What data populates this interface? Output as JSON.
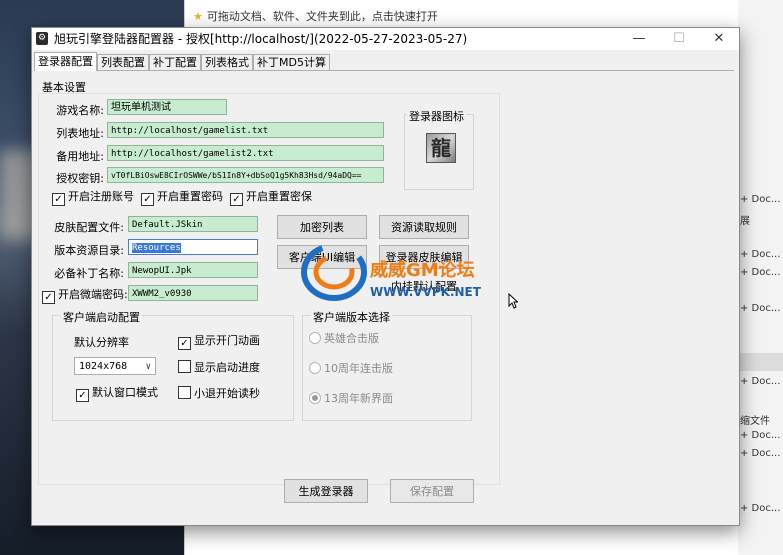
{
  "background": {
    "hint_text": "可拖动文档、软件、文件夹到此，点击快速打开",
    "right_list": [
      "+ Doc...",
      "展",
      "+ Doc...",
      "+ Doc...",
      "+ Doc...",
      "+ Doc...",
      "缩文件",
      "+ Doc...",
      "+ Doc...",
      "+ Doc..."
    ]
  },
  "window": {
    "title": "旭玩引擎登陆器配置器 - 授权[http://localhost/](2022-05-27-2023-05-27)",
    "controls": {
      "minimize": "—",
      "maximize": "☐",
      "close": "✕"
    }
  },
  "tabs": [
    "登录器配置",
    "列表配置",
    "补丁配置",
    "列表格式",
    "补丁MD5计算"
  ],
  "basic": {
    "section_title": "基本设置",
    "game_name_label": "游戏名称:",
    "game_name": "坦玩单机测试",
    "list_url_label": "列表地址:",
    "list_url": "http://localhost/gamelist.txt",
    "backup_url_label": "备用地址:",
    "backup_url": "http://localhost/gamelist2.txt",
    "key_label": "授权密钥:",
    "key": "vT0fLBiOswE8CIrOSWWe/bS1In8Y+dbSoQ1g5Kh83Hsd/94aDQ==",
    "icon_group": "登录器图标",
    "icon_glyph": "龍",
    "cb_register": "开启注册账号",
    "cb_reset_pwd": "开启重置密码",
    "cb_reset_protect": "开启重置密保"
  },
  "resources": {
    "skin_label": "皮肤配置文件:",
    "skin": "Default.JSkin",
    "res_dir_label": "版本资源目录:",
    "res_dir": "Resources",
    "patch_label": "必备补丁名称:",
    "patch": "NewopUI.Jpk",
    "micro_pwd_label": "开启微端密码:",
    "micro_pwd": "XWWM2_v0930",
    "btn_encrypt": "加密列表",
    "btn_read_rule": "资源读取规则",
    "btn_client_ui": "客户端UI编辑",
    "btn_skin_edit": "登录器皮肤编辑",
    "btn_builtin": "内挂默认配置"
  },
  "client_launch": {
    "group_title": "客户端启动配置",
    "resolution_label": "默认分辨率",
    "resolution": "1024x768",
    "cb_open_anim": "显示开门动画",
    "cb_progress": "显示启动进度",
    "cb_window_mode": "默认窗口模式",
    "cb_small_exit": "小退开始读秒"
  },
  "client_version": {
    "group_title": "客户端版本选择",
    "options": [
      "英雄合击版",
      "10周年连击版",
      "13周年新界面"
    ],
    "selected_index": 2
  },
  "footer": {
    "generate": "生成登录器",
    "save": "保存配置"
  },
  "watermark": {
    "cn": "威威GM论坛",
    "url": "WWW.VVPK.NET"
  }
}
